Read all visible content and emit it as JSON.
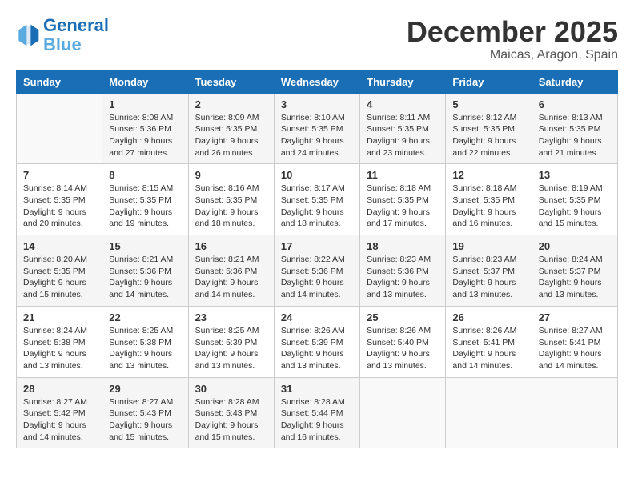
{
  "header": {
    "logo_line1": "General",
    "logo_line2": "Blue",
    "month": "December 2025",
    "location": "Maicas, Aragon, Spain"
  },
  "days_of_week": [
    "Sunday",
    "Monday",
    "Tuesday",
    "Wednesday",
    "Thursday",
    "Friday",
    "Saturday"
  ],
  "weeks": [
    [
      {
        "day": "",
        "info": ""
      },
      {
        "day": "1",
        "info": "Sunrise: 8:08 AM\nSunset: 5:36 PM\nDaylight: 9 hours\nand 27 minutes."
      },
      {
        "day": "2",
        "info": "Sunrise: 8:09 AM\nSunset: 5:35 PM\nDaylight: 9 hours\nand 26 minutes."
      },
      {
        "day": "3",
        "info": "Sunrise: 8:10 AM\nSunset: 5:35 PM\nDaylight: 9 hours\nand 24 minutes."
      },
      {
        "day": "4",
        "info": "Sunrise: 8:11 AM\nSunset: 5:35 PM\nDaylight: 9 hours\nand 23 minutes."
      },
      {
        "day": "5",
        "info": "Sunrise: 8:12 AM\nSunset: 5:35 PM\nDaylight: 9 hours\nand 22 minutes."
      },
      {
        "day": "6",
        "info": "Sunrise: 8:13 AM\nSunset: 5:35 PM\nDaylight: 9 hours\nand 21 minutes."
      }
    ],
    [
      {
        "day": "7",
        "info": "Sunrise: 8:14 AM\nSunset: 5:35 PM\nDaylight: 9 hours\nand 20 minutes."
      },
      {
        "day": "8",
        "info": "Sunrise: 8:15 AM\nSunset: 5:35 PM\nDaylight: 9 hours\nand 19 minutes."
      },
      {
        "day": "9",
        "info": "Sunrise: 8:16 AM\nSunset: 5:35 PM\nDaylight: 9 hours\nand 18 minutes."
      },
      {
        "day": "10",
        "info": "Sunrise: 8:17 AM\nSunset: 5:35 PM\nDaylight: 9 hours\nand 18 minutes."
      },
      {
        "day": "11",
        "info": "Sunrise: 8:18 AM\nSunset: 5:35 PM\nDaylight: 9 hours\nand 17 minutes."
      },
      {
        "day": "12",
        "info": "Sunrise: 8:18 AM\nSunset: 5:35 PM\nDaylight: 9 hours\nand 16 minutes."
      },
      {
        "day": "13",
        "info": "Sunrise: 8:19 AM\nSunset: 5:35 PM\nDaylight: 9 hours\nand 15 minutes."
      }
    ],
    [
      {
        "day": "14",
        "info": "Sunrise: 8:20 AM\nSunset: 5:35 PM\nDaylight: 9 hours\nand 15 minutes."
      },
      {
        "day": "15",
        "info": "Sunrise: 8:21 AM\nSunset: 5:36 PM\nDaylight: 9 hours\nand 14 minutes."
      },
      {
        "day": "16",
        "info": "Sunrise: 8:21 AM\nSunset: 5:36 PM\nDaylight: 9 hours\nand 14 minutes."
      },
      {
        "day": "17",
        "info": "Sunrise: 8:22 AM\nSunset: 5:36 PM\nDaylight: 9 hours\nand 14 minutes."
      },
      {
        "day": "18",
        "info": "Sunrise: 8:23 AM\nSunset: 5:36 PM\nDaylight: 9 hours\nand 13 minutes."
      },
      {
        "day": "19",
        "info": "Sunrise: 8:23 AM\nSunset: 5:37 PM\nDaylight: 9 hours\nand 13 minutes."
      },
      {
        "day": "20",
        "info": "Sunrise: 8:24 AM\nSunset: 5:37 PM\nDaylight: 9 hours\nand 13 minutes."
      }
    ],
    [
      {
        "day": "21",
        "info": "Sunrise: 8:24 AM\nSunset: 5:38 PM\nDaylight: 9 hours\nand 13 minutes."
      },
      {
        "day": "22",
        "info": "Sunrise: 8:25 AM\nSunset: 5:38 PM\nDaylight: 9 hours\nand 13 minutes."
      },
      {
        "day": "23",
        "info": "Sunrise: 8:25 AM\nSunset: 5:39 PM\nDaylight: 9 hours\nand 13 minutes."
      },
      {
        "day": "24",
        "info": "Sunrise: 8:26 AM\nSunset: 5:39 PM\nDaylight: 9 hours\nand 13 minutes."
      },
      {
        "day": "25",
        "info": "Sunrise: 8:26 AM\nSunset: 5:40 PM\nDaylight: 9 hours\nand 13 minutes."
      },
      {
        "day": "26",
        "info": "Sunrise: 8:26 AM\nSunset: 5:41 PM\nDaylight: 9 hours\nand 14 minutes."
      },
      {
        "day": "27",
        "info": "Sunrise: 8:27 AM\nSunset: 5:41 PM\nDaylight: 9 hours\nand 14 minutes."
      }
    ],
    [
      {
        "day": "28",
        "info": "Sunrise: 8:27 AM\nSunset: 5:42 PM\nDaylight: 9 hours\nand 14 minutes."
      },
      {
        "day": "29",
        "info": "Sunrise: 8:27 AM\nSunset: 5:43 PM\nDaylight: 9 hours\nand 15 minutes."
      },
      {
        "day": "30",
        "info": "Sunrise: 8:28 AM\nSunset: 5:43 PM\nDaylight: 9 hours\nand 15 minutes."
      },
      {
        "day": "31",
        "info": "Sunrise: 8:28 AM\nSunset: 5:44 PM\nDaylight: 9 hours\nand 16 minutes."
      },
      {
        "day": "",
        "info": ""
      },
      {
        "day": "",
        "info": ""
      },
      {
        "day": "",
        "info": ""
      }
    ]
  ]
}
